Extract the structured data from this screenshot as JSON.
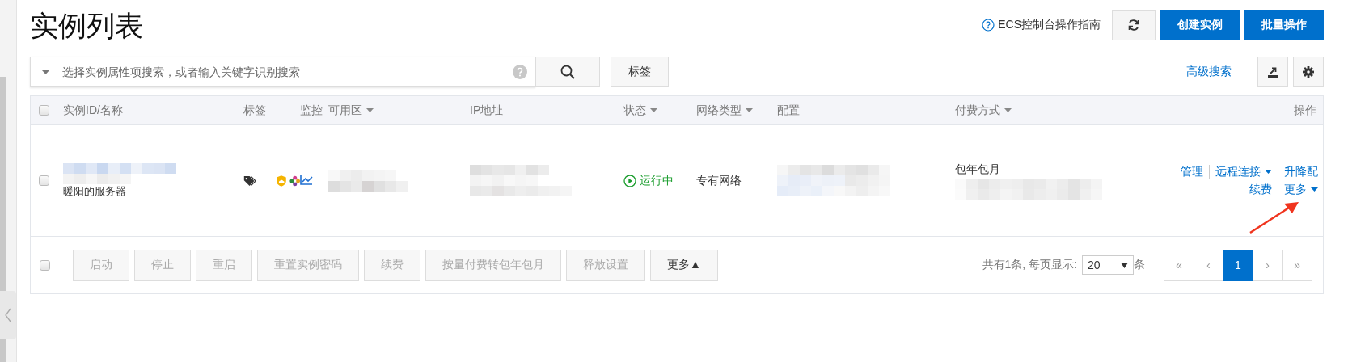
{
  "page_title": "实例列表",
  "header_actions": {
    "guide_link": "ECS控制台操作指南",
    "buttons": [
      {
        "label": "创建实例"
      },
      {
        "label": "批量操作"
      }
    ]
  },
  "search": {
    "placeholder": "选择实例属性项搜索，或者输入关键字识别搜索",
    "tag_button": "标签",
    "advanced_search": "高级搜索"
  },
  "table": {
    "select_all_checked": false,
    "columns": [
      {
        "label": "实例ID/名称",
        "filter": false
      },
      {
        "label": "标签",
        "filter": false
      },
      {
        "label": "监控",
        "filter": false
      },
      {
        "label": "可用区",
        "filter": true
      },
      {
        "label": "IP地址",
        "filter": false
      },
      {
        "label": "状态",
        "filter": true
      },
      {
        "label": "网络类型",
        "filter": true
      },
      {
        "label": "配置",
        "filter": false
      },
      {
        "label": "付费方式",
        "filter": true
      },
      {
        "label": "操作",
        "filter": false
      }
    ],
    "rows": [
      {
        "checked": false,
        "name": "暖阳的服务器",
        "status": "运行中",
        "network_type": "专有网络",
        "billing": "包年包月",
        "actions": [
          [
            {
              "label": "管理",
              "dropdown": false
            },
            {
              "label": "远程连接",
              "dropdown": true
            },
            {
              "label": "升降配",
              "dropdown": false
            }
          ],
          [
            {
              "label": "续费",
              "dropdown": false
            },
            {
              "label": "更多",
              "dropdown": true
            }
          ]
        ]
      }
    ]
  },
  "footer": {
    "select_all_checked": false,
    "buttons": [
      {
        "label": "启动",
        "disabled": true
      },
      {
        "label": "停止",
        "disabled": true
      },
      {
        "label": "重启",
        "disabled": true
      },
      {
        "label": "重置实例密码",
        "disabled": true
      },
      {
        "label": "续费",
        "disabled": true
      },
      {
        "label": "按量付费转包年包月",
        "disabled": true
      },
      {
        "label": "释放设置",
        "disabled": true
      },
      {
        "label": "更多▲",
        "disabled": false
      }
    ],
    "summary": "共有1条, 每页显示:",
    "page_size": "20",
    "unit": "条",
    "pages": [
      {
        "label": "«",
        "selected": false
      },
      {
        "label": "‹",
        "selected": false
      },
      {
        "label": "1",
        "selected": true
      },
      {
        "label": "›",
        "selected": false
      },
      {
        "label": "»",
        "selected": false
      }
    ]
  }
}
